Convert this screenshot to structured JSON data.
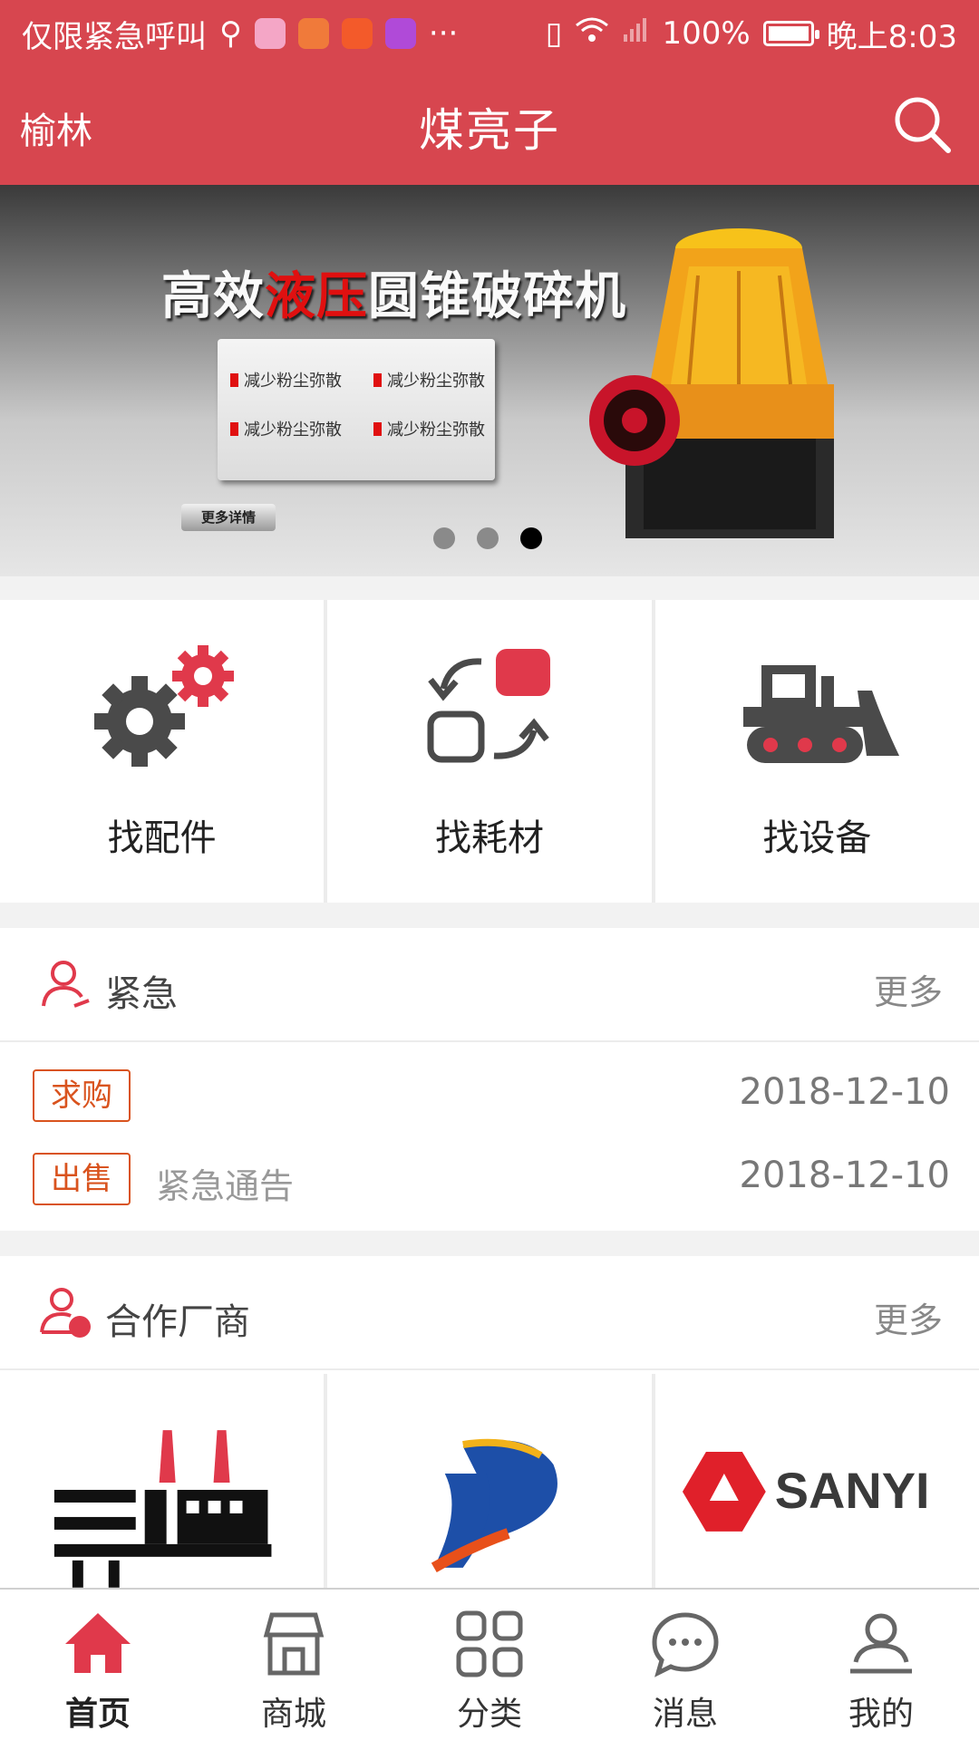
{
  "status_bar": {
    "carrier_text": "仅限紧急呼叫",
    "more": "···",
    "battery": "100%",
    "time": "晚上8:03"
  },
  "header": {
    "city": "榆林",
    "title": "煤亮子",
    "search_icon": "search-icon"
  },
  "banner": {
    "headline_part1": "高效",
    "headline_highlight": "液压",
    "headline_part2": "圆锥破碎机",
    "features": [
      "减少粉尘弥散",
      "减少粉尘弥散",
      "减少粉尘弥散",
      "减少粉尘弥散"
    ],
    "more_label": "更多详情",
    "slide_count": 3,
    "active_slide": 3,
    "highlight_color": "#e01010"
  },
  "categories": [
    {
      "label": "找配件",
      "icon": "gears-icon"
    },
    {
      "label": "找耗材",
      "icon": "exchange-icon"
    },
    {
      "label": "找设备",
      "icon": "bulldozer-icon"
    }
  ],
  "urgent": {
    "title": "紧急",
    "more": "更多",
    "icon": "user-urgent-icon",
    "items": [
      {
        "tag": "求购",
        "text": "",
        "date": "2018-12-10"
      },
      {
        "tag": "出售",
        "text": "紧急通告",
        "date": "2018-12-10"
      }
    ]
  },
  "partners": {
    "title": "合作厂商",
    "more": "更多",
    "icon": "supplier-icon",
    "logos": [
      {
        "name": "factory-logo"
      },
      {
        "name": "d-swoosh-logo"
      },
      {
        "name": "sanyi-logo",
        "text": "SANYI"
      }
    ]
  },
  "tabbar": {
    "items": [
      {
        "label": "首页",
        "icon": "home-icon",
        "active": true
      },
      {
        "label": "商城",
        "icon": "shop-icon",
        "active": false
      },
      {
        "label": "分类",
        "icon": "grid-icon",
        "active": false
      },
      {
        "label": "消息",
        "icon": "message-icon",
        "active": false
      },
      {
        "label": "我的",
        "icon": "profile-icon",
        "active": false
      }
    ]
  },
  "colors": {
    "brand_red": "#d7464f",
    "tag_orange": "#d9531e",
    "icon_gray": "#4a4a4a",
    "icon_red": "#e0394b"
  }
}
